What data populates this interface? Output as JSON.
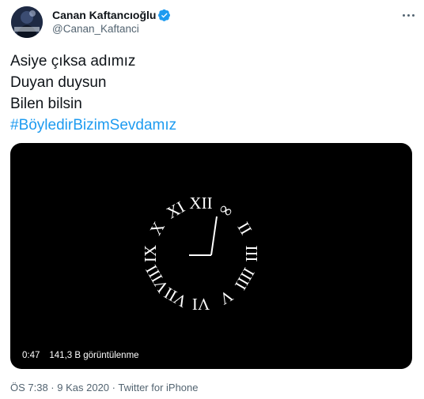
{
  "user": {
    "display_name": "Canan Kaftancıoğlu",
    "handle": "@Canan_Kaftanci"
  },
  "tweet": {
    "lines": [
      "Asiye çıksa adımız",
      "Duyan duysun",
      "Bilen bilsin"
    ],
    "hashtag": "#BöyledirBizimSevdamız"
  },
  "video": {
    "duration": "0:47",
    "views": "141,3 B görüntülenme",
    "clock_numerals": [
      "XII",
      "∞",
      "II",
      "III",
      "IIII",
      "V",
      "VI",
      "VII",
      "VIII",
      "IX",
      "X",
      "XI"
    ]
  },
  "meta": {
    "text": "ÖS 7:38 · 9 Kas 2020 · Twitter for iPhone"
  },
  "colors": {
    "link": "#1d9bf0",
    "verified": "#1d9bf0",
    "secondary_text": "#536471"
  },
  "icons": {
    "verified": "verified-badge-icon",
    "more": "more-options-icon"
  }
}
